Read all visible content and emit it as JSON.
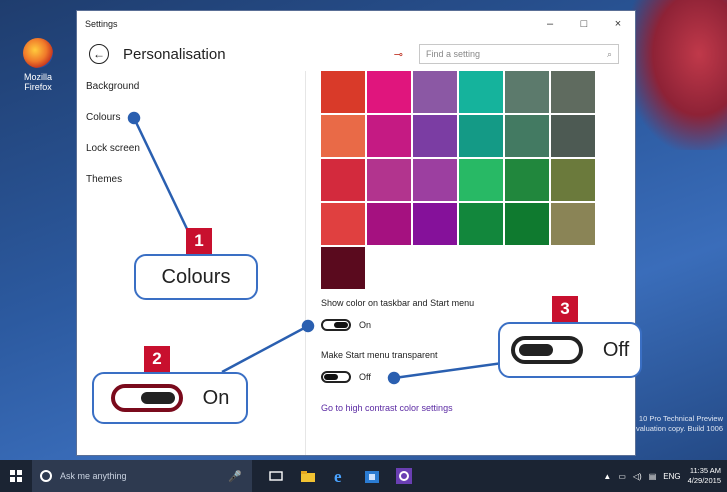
{
  "desktop": {
    "icon_label_line1": "Mozilla",
    "icon_label_line2": "Firefox",
    "watermark_line1": "10 Pro Technical Preview",
    "watermark_line2": "Evaluation copy. Build 1006"
  },
  "window": {
    "title": "Settings",
    "minimize": "–",
    "maximize": "□",
    "close": "×",
    "back_glyph": "←",
    "page_title": "Personalisation",
    "pin_glyph": "⊸",
    "search_placeholder": "Find a setting",
    "search_glyph": "⌕"
  },
  "sidebar": {
    "items": [
      {
        "label": "Background"
      },
      {
        "label": "Colours"
      },
      {
        "label": "Lock screen"
      },
      {
        "label": "Themes"
      }
    ]
  },
  "colors": {
    "swatches": [
      [
        "#d93a29",
        "#e0157d",
        "#8b58a4",
        "#15b39c",
        "#5c7a6c",
        "#5f6b5f"
      ],
      [
        "#e96a47",
        "#c51a83",
        "#7b3da3",
        "#149a86",
        "#437a62",
        "#4d5a53"
      ],
      [
        "#d32a3d",
        "#b2348e",
        "#9c3fa0",
        "#28b965",
        "#21873d",
        "#6b7a3c"
      ],
      [
        "#e04040",
        "#a51180",
        "#85119a",
        "#12873c",
        "#0f7a2f",
        "#8a8456"
      ],
      [
        "#5a0a1e"
      ]
    ]
  },
  "settings": {
    "taskbar_label": "Show color on taskbar and Start menu",
    "taskbar_state": "On",
    "transparent_label": "Make Start menu transparent",
    "transparent_state": "Off",
    "high_contrast_link": "Go to high contrast color settings"
  },
  "callouts": {
    "one_number": "1",
    "one_text": "Colours",
    "two_number": "2",
    "two_text": "On",
    "three_number": "3",
    "three_text": "Off",
    "accent": "#c8102e",
    "line_color": "#2a5fb0"
  },
  "taskbar": {
    "search_text": "Ask me anything",
    "mic_glyph": "🎤",
    "icons": [
      "task-view-icon",
      "file-explorer-icon",
      "edge-icon",
      "store-icon",
      "settings-icon"
    ],
    "tray_up": "▲",
    "tray_lang": "ENG",
    "time": "11:35 AM",
    "date": "4/29/2015"
  }
}
